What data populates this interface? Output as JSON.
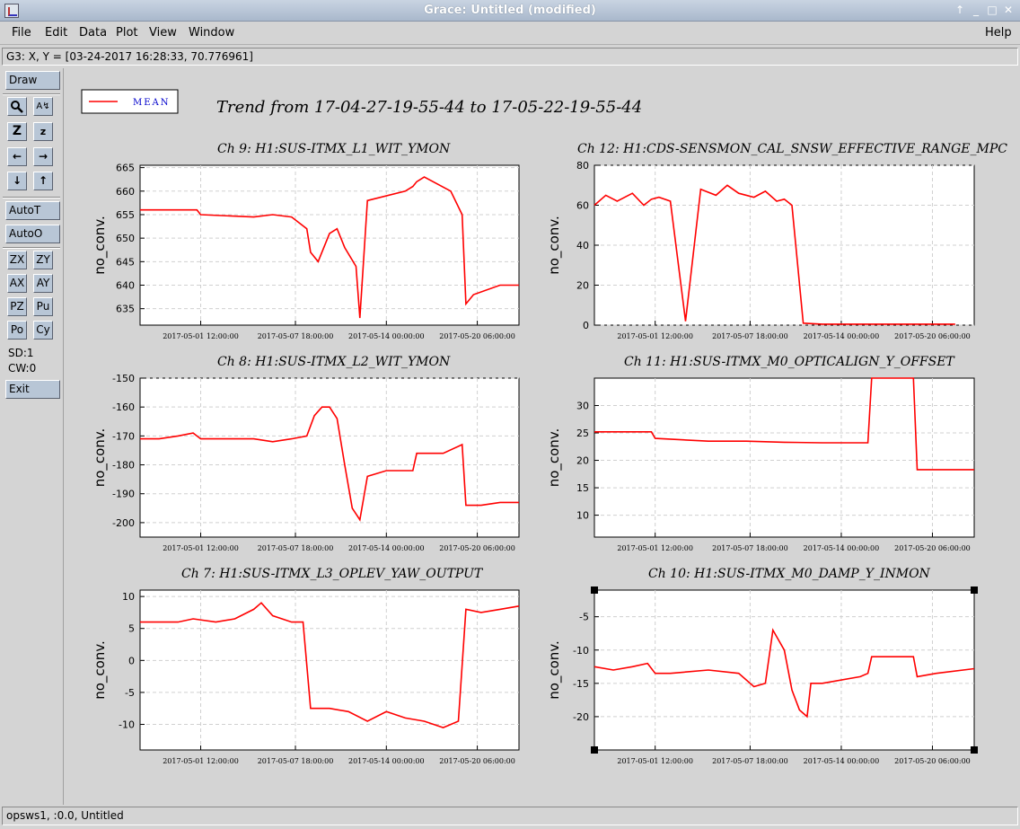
{
  "window": {
    "title": "Grace: Untitled (modified)",
    "controls": [
      "up-arrow-icon",
      "minimize-icon",
      "maximize-icon",
      "close-icon"
    ]
  },
  "menubar": {
    "file": "File",
    "edit": "Edit",
    "data": "Data",
    "plot": "Plot",
    "view": "View",
    "window": "Window",
    "help": "Help"
  },
  "locator": "G3: X, Y = [03-24-2017 16:28:33, 70.776961]",
  "tools": {
    "draw": "Draw",
    "autot": "AutoT",
    "autoo": "AutoO",
    "zx": "ZX",
    "zy": "ZY",
    "ax": "AX",
    "ay": "AY",
    "pz": "PZ",
    "pu": "Pu",
    "po": "Po",
    "cy": "Cy",
    "sd": "SD:1",
    "cw": "CW:0",
    "exit": "Exit"
  },
  "status": "opsws1, :0.0, Untitled",
  "colors": {
    "series": "#ff0000",
    "panel_bg": "#d4d4d4",
    "plot_bg": "#ffffff",
    "grid": "#d0d0d0"
  },
  "legend": {
    "label": "MEAN"
  },
  "main_title": "Trend from 17-04-27-19-55-44 to 17-05-22-19-55-44",
  "chart_data": [
    {
      "type": "line",
      "title": "Ch 9: H1:SUS-ITMX_L1_WIT_YMON",
      "ylabel": "no_conv.",
      "ylim": [
        631.5,
        665.5
      ],
      "yticks": [
        635,
        640,
        645,
        650,
        655,
        660,
        665
      ],
      "xtick_labels": [
        "2017-05-01 12:00:00",
        "2017-05-07 18:00:00",
        "2017-05-14 00:00:00",
        "2017-05-20 06:00:00"
      ],
      "series": [
        {
          "x": [
            0,
            0.02,
            0.03,
            0.1,
            0.15,
            0.16,
            0.3,
            0.35,
            0.4,
            0.44,
            0.45,
            0.47,
            0.5,
            0.52,
            0.54,
            0.57,
            0.58,
            0.6,
            0.7,
            0.72,
            0.73,
            0.75,
            0.82,
            0.85,
            0.86,
            0.88,
            0.95,
            1.0
          ],
          "y": [
            656,
            656,
            656,
            656,
            656,
            655,
            654.5,
            655,
            654.5,
            652,
            647,
            645,
            651,
            652,
            648,
            644,
            633,
            658,
            660,
            661,
            662,
            663,
            660,
            655,
            636,
            638,
            640,
            640
          ]
        }
      ]
    },
    {
      "type": "line",
      "title": "Ch 12: H1:CDS-SENSMON_CAL_SNSW_EFFECTIVE_RANGE_MPC",
      "ylabel": "no_conv.",
      "ylim": [
        0,
        80
      ],
      "yticks": [
        0,
        20,
        40,
        60,
        80
      ],
      "xtick_labels": [
        "2017-05-01 12:00:00",
        "2017-05-07 18:00:00",
        "2017-05-14 00:00:00",
        "2017-05-20 06:00:00"
      ],
      "series": [
        {
          "x": [
            0,
            0.03,
            0.06,
            0.1,
            0.13,
            0.15,
            0.17,
            0.2,
            0.24,
            0.28,
            0.32,
            0.35,
            0.38,
            0.42,
            0.45,
            0.48,
            0.5,
            0.52,
            0.55,
            0.6,
            0.7,
            0.8,
            0.9,
            0.95
          ],
          "y": [
            60,
            65,
            62,
            66,
            60,
            63,
            64,
            62,
            2,
            68,
            65,
            70,
            66,
            64,
            67,
            62,
            63,
            60,
            1,
            0.5,
            0.5,
            0.5,
            0.5,
            0.5
          ]
        }
      ]
    },
    {
      "type": "line",
      "title": "Ch 8: H1:SUS-ITMX_L2_WIT_YMON",
      "ylabel": "no_conv.",
      "ylim": [
        -205,
        -150
      ],
      "yticks": [
        -150,
        -160,
        -170,
        -180,
        -190,
        -200
      ],
      "xtick_labels": [
        "2017-05-01 12:00:00",
        "2017-05-07 18:00:00",
        "2017-05-14 00:00:00",
        "2017-05-20 06:00:00"
      ],
      "series": [
        {
          "x": [
            0,
            0.05,
            0.1,
            0.14,
            0.16,
            0.2,
            0.3,
            0.35,
            0.4,
            0.44,
            0.46,
            0.48,
            0.5,
            0.52,
            0.54,
            0.56,
            0.58,
            0.6,
            0.65,
            0.72,
            0.73,
            0.8,
            0.85,
            0.86,
            0.9,
            0.95,
            1.0
          ],
          "y": [
            -171,
            -171,
            -170,
            -169,
            -171,
            -171,
            -171,
            -172,
            -171,
            -170,
            -163,
            -160,
            -160,
            -164,
            -180,
            -195,
            -199,
            -184,
            -182,
            -182,
            -176,
            -176,
            -173,
            -194,
            -194,
            -193,
            -193
          ]
        }
      ]
    },
    {
      "type": "line",
      "title": "Ch 11: H1:SUS-ITMX_M0_OPTICALIGN_Y_OFFSET",
      "ylabel": "no_conv.",
      "ylim": [
        6,
        35
      ],
      "yticks": [
        10,
        15,
        20,
        25,
        30
      ],
      "xtick_labels": [
        "2017-05-01 12:00:00",
        "2017-05-07 18:00:00",
        "2017-05-14 00:00:00",
        "2017-05-20 06:00:00"
      ],
      "series": [
        {
          "x": [
            0,
            0.15,
            0.16,
            0.3,
            0.4,
            0.5,
            0.6,
            0.72,
            0.73,
            0.84,
            0.85,
            1.0
          ],
          "y": [
            25.2,
            25.2,
            24,
            23.5,
            23.5,
            23.3,
            23.2,
            23.2,
            35,
            35,
            18.3,
            18.3
          ]
        }
      ]
    },
    {
      "type": "line",
      "title": "Ch 7: H1:SUS-ITMX_L3_OPLEV_YAW_OUTPUT",
      "ylabel": "no_conv.",
      "ylim": [
        -14,
        11
      ],
      "yticks": [
        10,
        5,
        0,
        -5,
        -10
      ],
      "xtick_labels": [
        "2017-05-01 12:00:00",
        "2017-05-07 18:00:00",
        "2017-05-14 00:00:00",
        "2017-05-20 06:00:00"
      ],
      "series": [
        {
          "x": [
            0,
            0.1,
            0.14,
            0.2,
            0.25,
            0.3,
            0.32,
            0.35,
            0.4,
            0.43,
            0.45,
            0.5,
            0.55,
            0.6,
            0.65,
            0.7,
            0.75,
            0.8,
            0.84,
            0.86,
            0.9,
            0.95,
            1.0
          ],
          "y": [
            6,
            6,
            6.5,
            6,
            6.5,
            8,
            9,
            7,
            6,
            6,
            -7.5,
            -7.5,
            -8,
            -9.5,
            -8,
            -9,
            -9.5,
            -10.5,
            -9.5,
            8,
            7.5,
            8,
            8.5
          ]
        }
      ]
    },
    {
      "type": "line",
      "title": "Ch 10: H1:SUS-ITMX_M0_DAMP_Y_INMON",
      "ylabel": "no_conv.",
      "ylim": [
        -25,
        -1
      ],
      "yticks": [
        -5,
        -10,
        -15,
        -20
      ],
      "xtick_labels": [
        "2017-05-01 12:00:00",
        "2017-05-07 18:00:00",
        "2017-05-14 00:00:00",
        "2017-05-20 06:00:00"
      ],
      "series": [
        {
          "x": [
            0,
            0.05,
            0.1,
            0.14,
            0.16,
            0.2,
            0.3,
            0.38,
            0.42,
            0.45,
            0.47,
            0.5,
            0.52,
            0.54,
            0.56,
            0.57,
            0.6,
            0.7,
            0.72,
            0.73,
            0.84,
            0.85,
            0.9,
            1.0
          ],
          "y": [
            -12.5,
            -13,
            -12.5,
            -12,
            -13.5,
            -13.5,
            -13,
            -13.5,
            -15.5,
            -15,
            -7,
            -10,
            -16,
            -19,
            -20,
            -15,
            -15,
            -14,
            -13.5,
            -11,
            -11,
            -14,
            -13.5,
            -12.8
          ]
        }
      ]
    }
  ]
}
